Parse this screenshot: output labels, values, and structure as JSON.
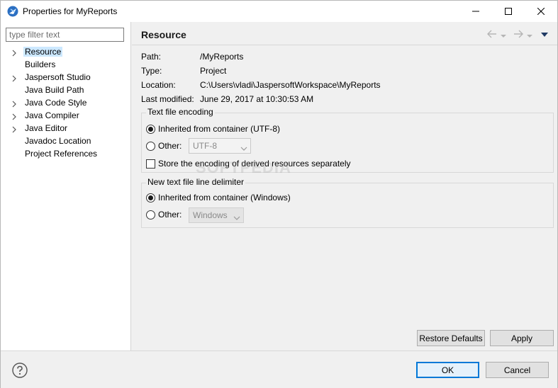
{
  "window": {
    "title": "Properties for MyReports"
  },
  "filter": {
    "placeholder": "type filter text"
  },
  "tree": {
    "items": [
      {
        "label": "Resource",
        "expandable": true,
        "selected": true
      },
      {
        "label": "Builders",
        "expandable": false
      },
      {
        "label": "Jaspersoft Studio",
        "expandable": true
      },
      {
        "label": "Java Build Path",
        "expandable": false
      },
      {
        "label": "Java Code Style",
        "expandable": true
      },
      {
        "label": "Java Compiler",
        "expandable": true
      },
      {
        "label": "Java Editor",
        "expandable": true
      },
      {
        "label": "Javadoc Location",
        "expandable": false
      },
      {
        "label": "Project References",
        "expandable": false
      }
    ]
  },
  "page": {
    "title": "Resource",
    "properties": [
      {
        "label": "Path:",
        "value": "/MyReports"
      },
      {
        "label": "Type:",
        "value": "Project"
      },
      {
        "label": "Location:",
        "value": "C:\\Users\\vladi\\JaspersoftWorkspace\\MyReports"
      },
      {
        "label": "Last modified:",
        "value": "June 29, 2017 at 10:30:53 AM"
      }
    ],
    "encoding_group": {
      "label": "Text file encoding",
      "inherited_label": "Inherited from container (UTF-8)",
      "other_label": "Other:",
      "other_value": "UTF-8",
      "store_label": "Store the encoding of derived resources separately"
    },
    "delimiter_group": {
      "label": "New text file line delimiter",
      "inherited_label": "Inherited from container (Windows)",
      "other_label": "Other:",
      "other_value": "Windows"
    },
    "restore_defaults_label": "Restore Defaults",
    "apply_label": "Apply"
  },
  "footer": {
    "ok_label": "OK",
    "cancel_label": "Cancel"
  },
  "watermark": "SOFTPEDIA",
  "colors": {
    "selection": "#cce8ff",
    "primary_button_border": "#0078d7",
    "window_bg": "#f0f0f0"
  }
}
